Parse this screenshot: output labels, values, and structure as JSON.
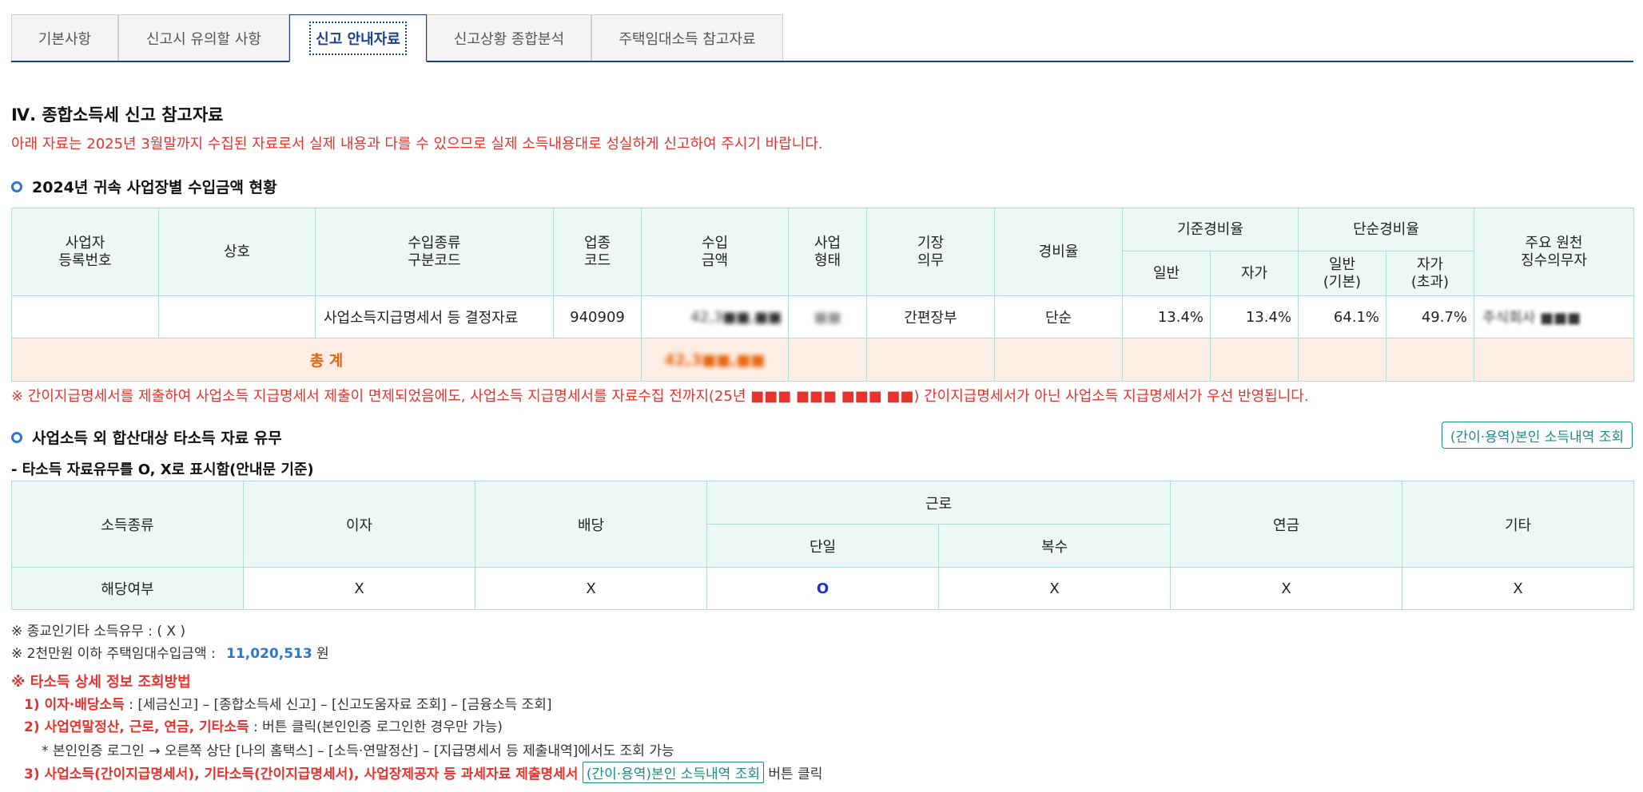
{
  "tabs": [
    {
      "label": "기본사항"
    },
    {
      "label": "신고시 유의할 사항"
    },
    {
      "label": "신고 안내자료"
    },
    {
      "label": "신고상황 종합분석"
    },
    {
      "label": "주택임대소득 참고자료"
    }
  ],
  "section_title": "Ⅳ. 종합소득세 신고 참고자료",
  "notice": "아래 자료는 2025년 3월말까지 수집된 자료로서 실제 내용과 다를 수 있으므로 실제 소득내용대로 성실하게 신고하여 주시기 바랍니다.",
  "income_section": {
    "title": "2024년 귀속 사업장별 수입금액 현황",
    "headers": {
      "reg_no": "사업자\n등록번호",
      "name": "상호",
      "type_code": "수입종류\n구분코드",
      "industry": "업종\n코드",
      "amount": "수입\n금액",
      "biz_type": "사업\n형태",
      "bookkeeping": "기장\n의무",
      "expense_rate": "경비율",
      "std_rate": "기준경비율",
      "simple_rate": "단순경비율",
      "withholder": "주요 원천\n징수의무자",
      "std_general": "일반",
      "std_self": "자가",
      "simple_general": "일반\n(기본)",
      "simple_self": "자가\n(초과)"
    },
    "row": {
      "reg_no": "",
      "name": "",
      "type_code": "사업소득지급명세서 등 결정자료",
      "industry": "940909",
      "amount": "42,3■■,■■",
      "biz_type": "■■",
      "bookkeeping": "간편장부",
      "expense_rate": "단순",
      "std_general": "13.4%",
      "std_self": "13.4%",
      "simple_general": "64.1%",
      "simple_self": "49.7%",
      "withholder": "주식회사 ■■■"
    },
    "total_label": "총 계",
    "total_amount": "42,3■■,■■"
  },
  "notice2": "※ 간이지급명세서를 제출하여 사업소득 지급명세서 제출이 면제되었음에도, 사업소득 지급명세서를 자료수집 전까지(25년 ■■■ ■■■ ■■■ ■■) 간이지급명세서가 아닌 사업소득 지급명세서가 우선 반영됩니다.",
  "other_income": {
    "title": "사업소득 외 합산대상 타소득 자료 유무",
    "lookup_button": "(간이·용역)본인 소득내역 조회",
    "mark_note": "- 타소득 자료유무를 O, X로 표시함(안내문 기준)",
    "headers": {
      "kind": "소득종류",
      "interest": "이자",
      "dividend": "배당",
      "labor": "근로",
      "single": "단일",
      "multiple": "복수",
      "pension": "연금",
      "etc": "기타"
    },
    "row": {
      "label": "해당여부",
      "interest": "X",
      "dividend": "X",
      "single": "O",
      "multiple": "X",
      "pension": "X",
      "etc": "X"
    }
  },
  "notes": {
    "religious": "※ 종교인기타 소득유무 : ( X )",
    "rental_prefix": "※ 2천만원 이하 주택임대수입금액 :",
    "rental_amount": "11,020,513",
    "rental_unit": "원"
  },
  "howto": {
    "title": "※ 타소득 상세 정보 조회방법",
    "item1_label": "1) 이자·배당소득",
    "item1_text": " : [세금신고] – [종합소득세 신고] – [신고도움자료 조회] – [금융소득 조회]",
    "item2_label": "2) 사업연말정산, 근로, 연금, 기타소득",
    "item2_text": " : 버튼 클릭(본인인증 로그인한 경우만 가능)",
    "item2_sub": "* 본인인증 로그인 → 오른쪽 상단 [나의 홈택스] – [소득·연말정산] – [지급명세서 등 제출내역]에서도 조회 가능",
    "item3_label": "3) 사업소득(간이지급명세서), 기타소득(간이지급명세서), 사업장제공자 등 과세자료 제출명세서",
    "item3_button": "(간이·용역)본인 소득내역 조회",
    "item3_suffix": " 버튼 클릭"
  }
}
